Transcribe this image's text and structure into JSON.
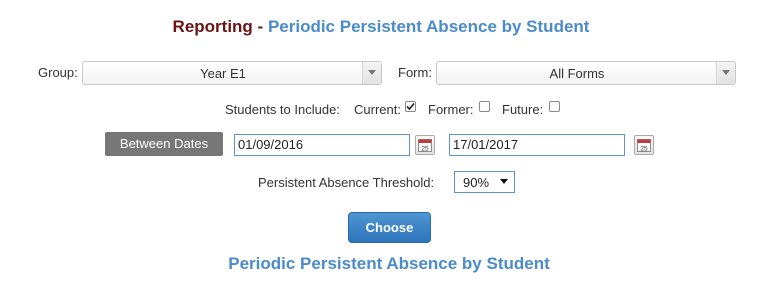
{
  "header": {
    "title_prefix": "Reporting - ",
    "title_main": "Periodic Persistent Absence by Student"
  },
  "filters": {
    "group_label": "Group:",
    "group_value": "Year E1",
    "form_label": "Form:",
    "form_value": "All Forms"
  },
  "students": {
    "label": "Students to Include:",
    "current_label": "Current:",
    "current_checked": true,
    "former_label": "Former:",
    "former_checked": false,
    "future_label": "Future:",
    "future_checked": false
  },
  "dates": {
    "mode_button": "Between Dates",
    "start": "01/09/2016",
    "end": "17/01/2017",
    "calendar_day": "25"
  },
  "threshold": {
    "label": "Persistent Absence Threshold:",
    "value": "90%"
  },
  "actions": {
    "choose_label": "Choose"
  },
  "report": {
    "title": "Periodic Persistent Absence by Student"
  },
  "colors": {
    "title_dark": "#6b1414",
    "title_blue": "#4a8bcb",
    "button_blue": "#3a82c6",
    "button_grey": "#777777"
  }
}
